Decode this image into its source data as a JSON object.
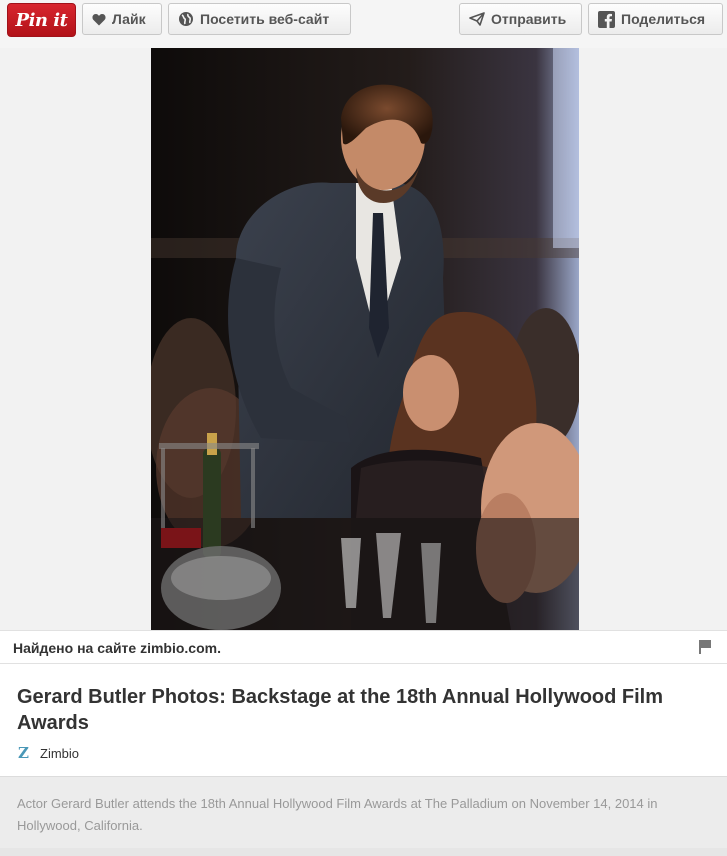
{
  "toolbar": {
    "pinit_label": "Pin it",
    "like_label": "Лайк",
    "visit_label": "Посетить веб-сайт",
    "send_label": "Отправить",
    "share_label": "Поделиться"
  },
  "photo": {
    "subject": "Gerard Butler at the 18th Annual Hollywood Film Awards"
  },
  "source": {
    "found_on": "Найдено на сайте zimbio.com."
  },
  "pin": {
    "title": "Gerard Butler Photos: Backstage at the 18th Annual Hollywood Film Awards",
    "domain_logo": "Z",
    "domain_name": "Zimbio",
    "description": "Actor Gerard Butler attends the 18th Annual Hollywood Film Awards at The Palladium on November 14, 2014 in Hollywood, California."
  },
  "colors": {
    "pinit_red": "#cb2027",
    "zimbio_blue": "#4a98b7"
  }
}
